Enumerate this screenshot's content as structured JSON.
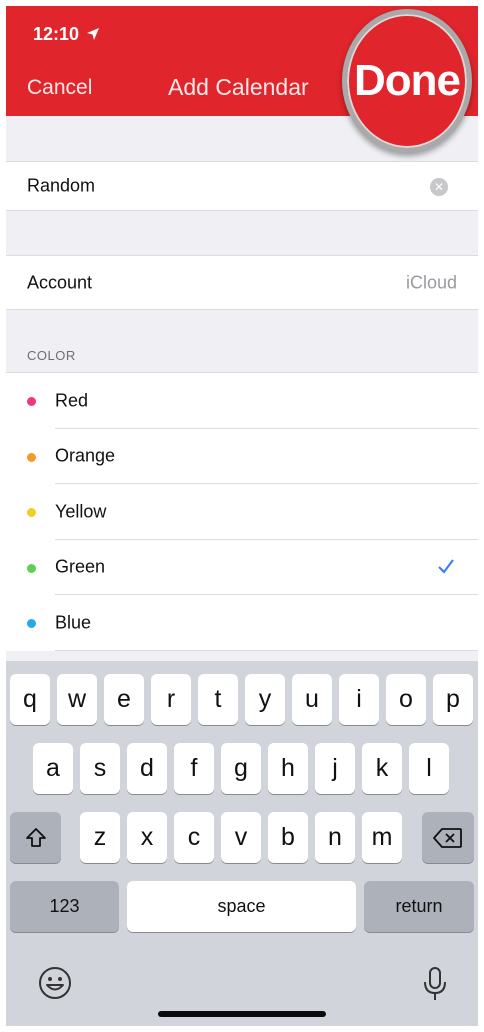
{
  "status_bar": {
    "time": "12:10",
    "location_icon": "location-arrow-icon"
  },
  "nav": {
    "cancel_label": "Cancel",
    "title": "Add Calendar",
    "done_label": "Done"
  },
  "name_field": {
    "value": "Random",
    "clear_icon": "clear-circle-icon"
  },
  "account": {
    "label": "Account",
    "value": "iCloud"
  },
  "color_section": {
    "header": "COLOR",
    "items": [
      {
        "label": "Red",
        "color": "#f2357f",
        "selected": false
      },
      {
        "label": "Orange",
        "color": "#f59a2a",
        "selected": false
      },
      {
        "label": "Yellow",
        "color": "#f4cc27",
        "selected": false
      },
      {
        "label": "Green",
        "color": "#5fd04f",
        "selected": true
      },
      {
        "label": "Blue",
        "color": "#27a9e7",
        "selected": false
      }
    ],
    "check_color": "#2f7cf6"
  },
  "keyboard": {
    "row1": [
      "q",
      "w",
      "e",
      "r",
      "t",
      "y",
      "u",
      "i",
      "o",
      "p"
    ],
    "row2": [
      "a",
      "s",
      "d",
      "f",
      "g",
      "h",
      "j",
      "k",
      "l"
    ],
    "row3": [
      "z",
      "x",
      "c",
      "v",
      "b",
      "n",
      "m"
    ],
    "numbers_label": "123",
    "space_label": "space",
    "return_label": "return",
    "shift_icon": "shift-icon",
    "delete_icon": "delete-backspace-icon",
    "emoji_icon": "emoji-icon",
    "mic_icon": "microphone-icon"
  },
  "colors": {
    "accent_red": "#e0252c"
  }
}
